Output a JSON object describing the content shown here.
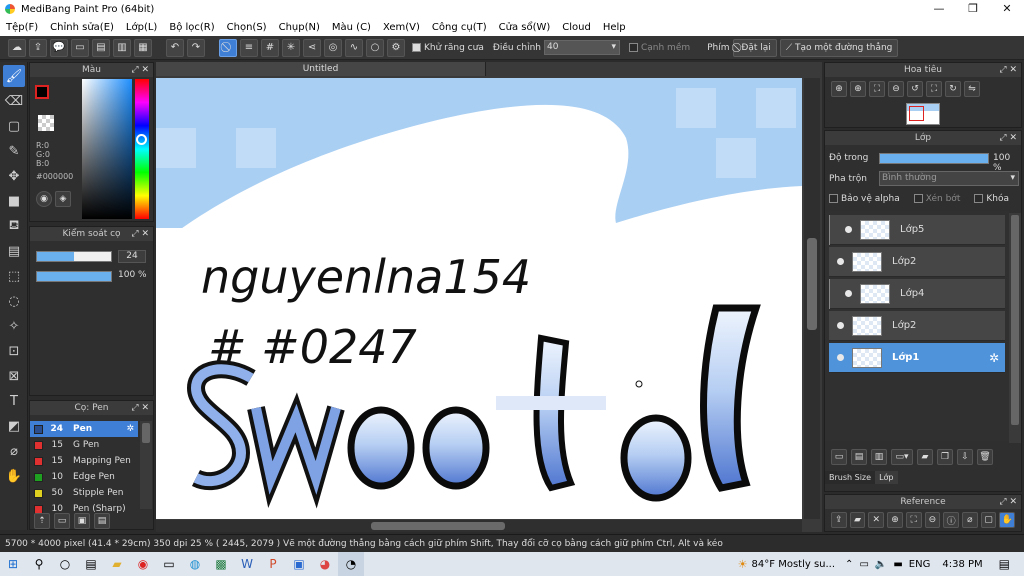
{
  "title": "MediBang Paint Pro (64bit)",
  "menu": [
    "Tệp(F)",
    "Chỉnh sửa(E)",
    "Lớp(L)",
    "Bộ lọc(R)",
    "Chọn(S)",
    "Chụp(N)",
    "Màu (C)",
    "Xem(V)",
    "Công cụ(T)",
    "Cửa sổ(W)",
    "Cloud",
    "Help"
  ],
  "toolbar": {
    "antialias_label": "Khử răng cưa",
    "adjust_label": "Điều chỉnh",
    "adjust_value": "40",
    "smooth_label": "Cạnh mềm",
    "key_label": "Phím",
    "reset_label": "Đặt lại",
    "line_label": "Tạo một đường thẳng"
  },
  "color_panel": {
    "title": "Màu",
    "r": "R:0",
    "g": "G:0",
    "b": "B:0",
    "hex": "#000000",
    "fg": "#000000",
    "bg": "#5a1b1b"
  },
  "brush_control": {
    "title": "Kiểm soát cọ",
    "size": "24",
    "opacity": "100 %",
    "size_frac": 0.5,
    "opacity_frac": 1.0
  },
  "brush_list": {
    "title": "Cọ: Pen",
    "items": [
      {
        "size": "24",
        "name": "Pen",
        "color": "#2a4e8e"
      },
      {
        "size": "15",
        "name": "G Pen",
        "color": "#e03030"
      },
      {
        "size": "15",
        "name": "Mapping Pen",
        "color": "#e03030"
      },
      {
        "size": "10",
        "name": "Edge Pen",
        "color": "#20a020"
      },
      {
        "size": "50",
        "name": "Stipple Pen",
        "color": "#e0d020"
      },
      {
        "size": "10",
        "name": "Pen (Sharp)",
        "color": "#e03030"
      }
    ]
  },
  "document": {
    "tab": "Untitled"
  },
  "navigator": {
    "title": "Hoa tiêu"
  },
  "layer_panel": {
    "title": "Lớp",
    "opacity_label": "Độ trong",
    "opacity_value": "100 %",
    "opacity_frac": 1.0,
    "blend_label": "Pha trộn",
    "blend_value": "Bình thường",
    "protect_alpha": "Bảo vệ alpha",
    "clip": "Xén bớt",
    "lock": "Khóa",
    "layers": [
      {
        "name": "Lớp5",
        "selected": false
      },
      {
        "name": "Lớp2",
        "selected": false
      },
      {
        "name": "Lớp4",
        "selected": false
      },
      {
        "name": "Lớp2",
        "selected": false
      },
      {
        "name": "Lớp1",
        "selected": true
      }
    ],
    "tabs": [
      "Brush Size",
      "Lớp"
    ]
  },
  "reference": {
    "title": "Reference"
  },
  "status": "5700 * 4000 pixel  (41.4 * 29cm)   350 dpi   25 %   ( 2445, 2079 )  Vẽ một đường thẳng bằng cách giữ phím Shift, Thay đổi cỡ cọ bằng cách giữ phím Ctrl, Alt và kéo",
  "taskbar": {
    "weather": "84°F  Mostly su...",
    "lang": "ENG",
    "time": "4:38 PM"
  },
  "canvas_text": {
    "handwriting1": "nguyenlna154",
    "handwriting2": "# #0247"
  },
  "colors": {
    "accent": "#3f7fd6",
    "canvas_sky": "#a9cff3",
    "letter_blue": "#6b93dc"
  }
}
